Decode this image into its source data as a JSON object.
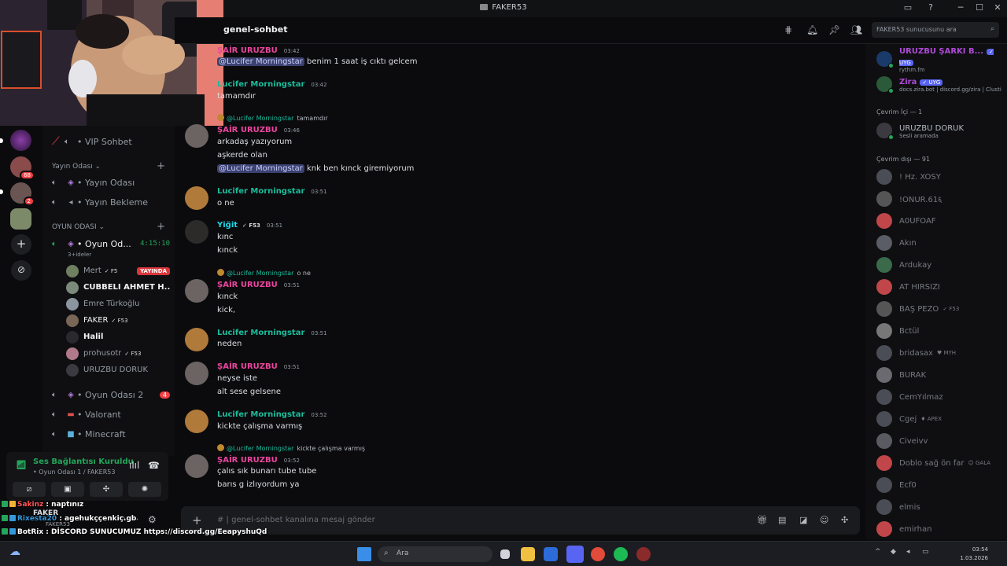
{
  "window": {
    "title": "FAKER53",
    "controls": {
      "minimize": "─",
      "maximize": "☐",
      "close": "✕"
    }
  },
  "rail": {
    "badges": [
      "68",
      "2"
    ]
  },
  "channels": {
    "top_channel": "VIP Sohbet",
    "cat_yayin": "Yayın Odası",
    "yayin_odasi": "Yayın Odası",
    "yayin_bekleme": "Yayın Bekleme",
    "cat_oyun": "OYUN ODASI",
    "oyun_odasi_1": "Oyun Od...",
    "timer": "4:15:10",
    "sub_label": "3+ideler",
    "voice_users": [
      {
        "name": "Mert",
        "tag": "✓ F5",
        "live": "YAYINDA"
      },
      {
        "name": "CÜBBELİ AHMET H...",
        "tag": "",
        "live": ""
      },
      {
        "name": "Emre Türkoğlu",
        "tag": "",
        "live": ""
      },
      {
        "name": "FAKER",
        "tag": "✓ F53",
        "live": ""
      },
      {
        "name": "Halil",
        "tag": "",
        "live": ""
      },
      {
        "name": "prohusotr",
        "tag": "✓ F53",
        "live": ""
      },
      {
        "name": "URUZBU DORUK",
        "tag": "",
        "live": ""
      }
    ],
    "oyun_odasi_2": "Oyun Odası 2",
    "oyun_odasi_2_count": "4",
    "valorant": "Valorant",
    "minecraft": "Minecraft"
  },
  "voice_panel": {
    "status": "Ses Bağlantısı Kuruldu",
    "sub": "• Oyun Odası 1 / FAKER53"
  },
  "topbar": {
    "channel": "genel-sohbet",
    "search_placeholder": "FAKER53 sunucusunu ara"
  },
  "messages": {
    "m1_author": "ŞAİR URUZBU",
    "m1_time": "03:42",
    "m1_mention": "@Lucifer Morningstar",
    "m1_text": " benim 1 saat iş cıktı gelcem",
    "m2_author": "Lucifer Morningstar",
    "m2_time": "03:42",
    "m2_text": "tamamdır",
    "m3_reply_name": "@Lucifer Morningstar",
    "m3_reply_text": "tamamdır",
    "m3_author": "ŞAİR URUZBU",
    "m3_time": "03:46",
    "m3_l1": "arkadaş yazıyorum",
    "m3_l2": "aşkerde olan",
    "m3_mention": "@Lucifer Morningstar",
    "m3_l3": " knk ben kınck giremiyorum",
    "m4_author": "Lucifer Morningstar",
    "m4_time": "03:51",
    "m4_text": "o ne",
    "m5_author": "Yiğit",
    "m5_role": "✓ F53",
    "m5_time": "03:51",
    "m5_l1": "kınc",
    "m5_l2": "kınck",
    "m6_reply_name": "@Lucifer Morningstar",
    "m6_reply_text": "o ne",
    "m6_author": "ŞAİR URUZBU",
    "m6_time": "03:51",
    "m6_l1": "kınck",
    "m6_l2": "kick,",
    "m7_author": "Lucifer Morningstar",
    "m7_time": "03:51",
    "m7_text": "neden",
    "m8_author": "ŞAİR URUZBU",
    "m8_time": "03:51",
    "m8_l1": "neyse iste",
    "m8_l2": "alt sese gelsene",
    "m9_author": "Lucifer Morningstar",
    "m9_time": "03:52",
    "m9_text": "kickte çalışma varmış",
    "m10_reply_name": "@Lucifer Morningstar",
    "m10_reply_text": "kickte çalışma varmış",
    "m10_author": "ŞAİR URUZBU",
    "m10_time": "03:52",
    "m10_l1": "çalıs sık bunarı tube tube",
    "m10_l2": "barıs g izlıyordum ya"
  },
  "composer": {
    "placeholder": "#  |  genel-sohbet kanalına mesaj gönder"
  },
  "members": {
    "bot1": {
      "name": "URUZBU ŞARKI B...",
      "app": "✓ UYG",
      "sub": "rythm.fm"
    },
    "bot2": {
      "name": "Zira",
      "app": "✓ UYG",
      "sub": "docs.zira.bot | discord.gg/zira | Clusti"
    },
    "online_header": "Çevrim İçi — 1",
    "online1": {
      "name": "URUZBU DORUK",
      "sub": "Sesli aramada"
    },
    "offline_header": "Çevrim dışı — 91",
    "offline": [
      {
        "name": "! Hz. XOSY",
        "tag": ""
      },
      {
        "name": "!ONUR.61६",
        "tag": ""
      },
      {
        "name": "A0UFOAF",
        "tag": ""
      },
      {
        "name": "Akın",
        "tag": ""
      },
      {
        "name": "Ardukay",
        "tag": ""
      },
      {
        "name": "AT HIRSIZI",
        "tag": ""
      },
      {
        "name": "BAŞ PEZO",
        "tag": "✓ F53"
      },
      {
        "name": "Bctül",
        "tag": ""
      },
      {
        "name": "bridasax",
        "tag": "♥ MYH"
      },
      {
        "name": "BURAK",
        "tag": ""
      },
      {
        "name": "CemYılmaz",
        "tag": ""
      },
      {
        "name": "Cgej",
        "tag": "♦ APEX"
      },
      {
        "name": "Civeivv",
        "tag": ""
      },
      {
        "name": "Doblo sağ ön far",
        "tag": "☺ GALA"
      },
      {
        "name": "Ecf0",
        "tag": ""
      },
      {
        "name": "elmis",
        "tag": ""
      },
      {
        "name": "emirhan",
        "tag": ""
      }
    ]
  },
  "overlay": {
    "l1_user": "Sakinz",
    "l1_text": " : naptınız",
    "l2_user": "Rixesta20",
    "l2_text": " : agehukççenkiç.gb",
    "l3_user": "BotRix",
    "l3_text": " : DİSCORD SUNUCUMUZ https://discord.gg/EeapyshuQd"
  },
  "under_overlay": {
    "name": "FAKER",
    "sub": "FAKER53"
  },
  "taskbar": {
    "search": "Ara",
    "time": "03:54",
    "date": "1.03.2026"
  },
  "colors": {
    "accent_green": "#23a55a",
    "teal_name": "#1abc9c",
    "pink_name": "#eb459e",
    "live_red": "#da373c",
    "blurple": "#5865f2"
  }
}
